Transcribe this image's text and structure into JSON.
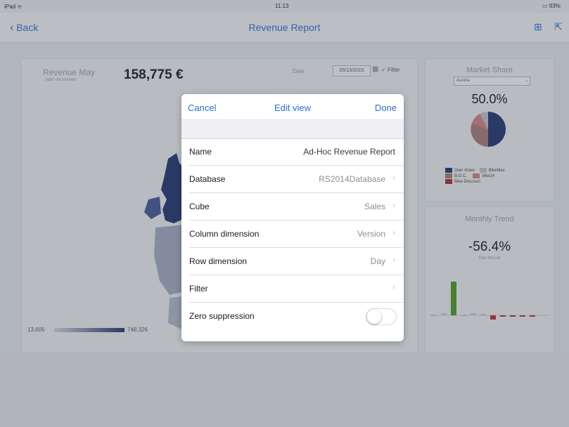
{
  "status": {
    "device": "iPad ᯤ",
    "time": "11:13",
    "battery": "93%"
  },
  "nav": {
    "back_label": "Back",
    "title": "Revenue Report"
  },
  "revenue": {
    "label": "Revenue May",
    "sublabel": "Valid via reviews",
    "value": "158,775 €",
    "date_label": "Date",
    "date_value": "05/13/2015",
    "filter_label": "Filter",
    "range_min": "13,605",
    "range_max": "748,326"
  },
  "market": {
    "title": "Market Share",
    "country": "Austria",
    "value": "50.0%",
    "legend": [
      {
        "label": "Own share",
        "color": "#1c2f6e"
      },
      {
        "label": "BikeMax",
        "color": "#c4c4c4"
      },
      {
        "label": "B.O.C.",
        "color": "#a97878"
      },
      {
        "label": "bike24",
        "color": "#d97f7f"
      },
      {
        "label": "Bike-Discount",
        "color": "#a52a2a"
      }
    ]
  },
  "trend": {
    "title": "Monthly Trend",
    "value": "-56.4%",
    "sublabel": "Max Bound"
  },
  "modal": {
    "cancel": "Cancel",
    "title": "Edit view",
    "done": "Done",
    "rows": [
      {
        "label": "Name",
        "value": "Ad-Hoc Revenue Report"
      },
      {
        "label": "Database",
        "value": "RS2014Database"
      },
      {
        "label": "Cube",
        "value": "Sales"
      },
      {
        "label": "Column dimension",
        "value": "Version"
      },
      {
        "label": "Row dimension",
        "value": "Day"
      },
      {
        "label": "Filter",
        "value": ""
      },
      {
        "label": "Zero suppression",
        "value": ""
      }
    ]
  },
  "colors": {
    "accent": "#2a6fd8",
    "map_dark": "#1c2f6e",
    "trend_green": "#4a9a1f",
    "trend_red": "#c0262b"
  }
}
